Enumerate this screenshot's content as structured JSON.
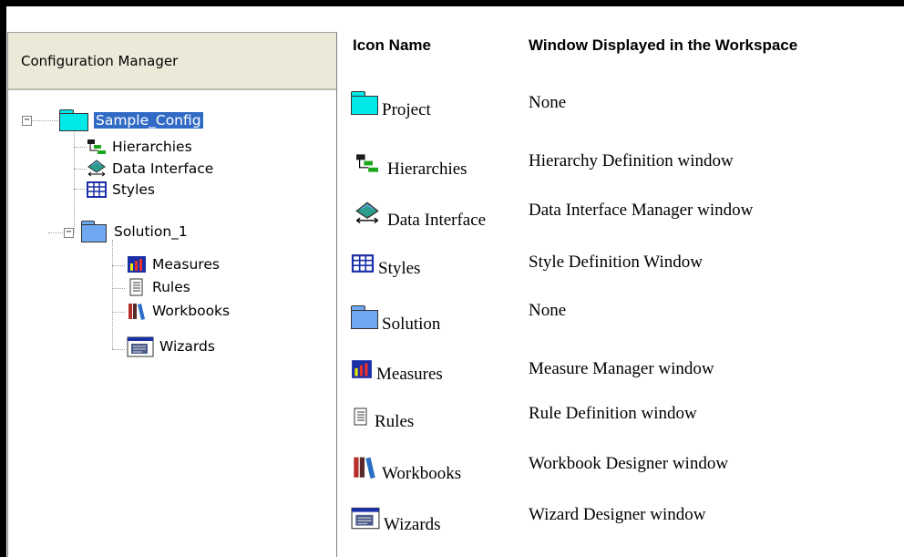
{
  "panel": {
    "title": "Configuration Manager"
  },
  "tree": {
    "project": "Sample_Config",
    "hierarchies": "Hierarchies",
    "data_interface": "Data Interface",
    "styles": "Styles",
    "solution": "Solution_1",
    "measures": "Measures",
    "rules": "Rules",
    "workbooks": "Workbooks",
    "wizards": "Wizards",
    "expander_symbol": "−"
  },
  "table": {
    "headers": [
      "Icon Name",
      "Window Displayed in the Workspace"
    ],
    "rows": [
      {
        "icon": "project-folder-icon",
        "name": "Project",
        "window": "None"
      },
      {
        "icon": "hierarchy-icon",
        "name": "Hierarchies",
        "window": "Hierarchy Definition window"
      },
      {
        "icon": "data-interface-icon",
        "name": "Data Interface",
        "window": "Data Interface Manager window"
      },
      {
        "icon": "styles-grid-icon",
        "name": "Styles",
        "window": "Style Definition Window"
      },
      {
        "icon": "solution-folder-icon",
        "name": "Solution",
        "window": "None"
      },
      {
        "icon": "measures-chart-icon",
        "name": "Measures",
        "window": "Measure Manager window"
      },
      {
        "icon": "rules-document-icon",
        "name": "Rules",
        "window": "Rule Definition window"
      },
      {
        "icon": "workbooks-icon",
        "name": "Workbooks",
        "window": "Workbook Designer window"
      },
      {
        "icon": "wizards-icon",
        "name": "Wizards",
        "window": "Wizard Designer window"
      }
    ]
  },
  "colors": {
    "project_folder": "#00e8e8",
    "solution_folder": "#6fa8f0",
    "selection": "#316ac5",
    "panel_header": "#ece9d8"
  }
}
